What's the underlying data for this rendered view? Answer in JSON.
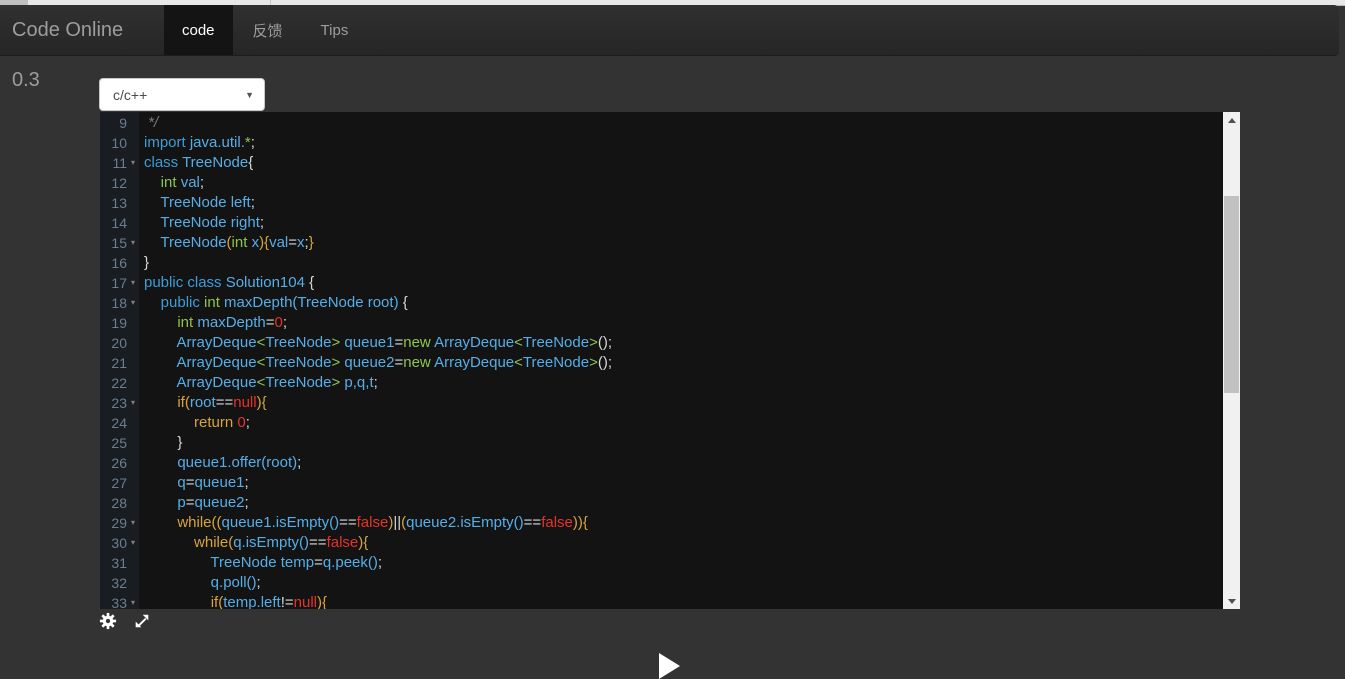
{
  "top_nav": {
    "brand": "Code Online 0.3",
    "tabs": [
      {
        "label": "code",
        "active": true
      },
      {
        "label": "反馈",
        "active": false
      },
      {
        "label": "Tips",
        "active": false
      }
    ]
  },
  "toolbar": {
    "language_select": {
      "value": "c/c++",
      "caret_icon": "▼"
    }
  },
  "colors": {
    "page_bg": "#333333",
    "navbar_bg": "#2b2b2b",
    "active_tab_bg": "#141414",
    "editor_bg": "#131313",
    "gutter_bg": "#191d22",
    "line_number": "#6b7e8f",
    "keyword_blue": "#3c9dd8",
    "keyword_green": "#8dc54f",
    "keyword_gold": "#d6a53c",
    "identifier_blue": "#56aee8",
    "literal_red": "#e5332b",
    "punctuation": "#d8d8d8",
    "comment_gray": "#7b7b7b",
    "scrollbar_track": "#f1f1f1",
    "scrollbar_thumb": "#c1c1c1"
  },
  "editor": {
    "fold_lines": [
      11,
      15,
      17,
      18,
      23,
      29,
      30,
      33
    ],
    "fold_icon": "▾",
    "lines": [
      {
        "n": 9,
        "tokens": [
          [
            " */",
            "com"
          ]
        ]
      },
      {
        "n": 10,
        "tokens": [
          [
            "import ",
            "kb"
          ],
          [
            "java.util.",
            "id"
          ],
          [
            "*",
            "kg"
          ],
          [
            ";",
            "pun"
          ]
        ]
      },
      {
        "n": 11,
        "tokens": [
          [
            "class ",
            "kb"
          ],
          [
            "TreeNode",
            "id"
          ],
          [
            "{",
            "pun"
          ]
        ]
      },
      {
        "n": 12,
        "tokens": [
          [
            "    ",
            "pun"
          ],
          [
            "int ",
            "kg"
          ],
          [
            "val",
            "id"
          ],
          [
            ";",
            "pun"
          ]
        ]
      },
      {
        "n": 13,
        "tokens": [
          [
            "    TreeNode left",
            "id"
          ],
          [
            ";",
            "pun"
          ]
        ]
      },
      {
        "n": 14,
        "tokens": [
          [
            "    TreeNode right",
            "id"
          ],
          [
            ";",
            "pun"
          ]
        ]
      },
      {
        "n": 15,
        "tokens": [
          [
            "    TreeNode",
            "id"
          ],
          [
            "(",
            "kd"
          ],
          [
            "int ",
            "kg"
          ],
          [
            "x",
            "id"
          ],
          [
            "){",
            "kd"
          ],
          [
            "val",
            "id"
          ],
          [
            "=",
            "pun"
          ],
          [
            "x",
            "id"
          ],
          [
            ";",
            "pun"
          ],
          [
            "}",
            "kd"
          ]
        ]
      },
      {
        "n": 16,
        "tokens": [
          [
            "}",
            "pun"
          ]
        ]
      },
      {
        "n": 17,
        "tokens": [
          [
            "public class ",
            "kb"
          ],
          [
            "Solution104 ",
            "id"
          ],
          [
            "{",
            "pun"
          ]
        ]
      },
      {
        "n": 18,
        "tokens": [
          [
            "    ",
            "pun"
          ],
          [
            "public ",
            "kb"
          ],
          [
            "int ",
            "kg"
          ],
          [
            "maxDepth(TreeNode root)",
            "id"
          ],
          [
            " {",
            "pun"
          ]
        ]
      },
      {
        "n": 19,
        "tokens": [
          [
            "        ",
            "pun"
          ],
          [
            "int ",
            "kg"
          ],
          [
            "maxDepth",
            "id"
          ],
          [
            "=",
            "pun"
          ],
          [
            "0",
            "lit"
          ],
          [
            ";",
            "pun"
          ]
        ]
      },
      {
        "n": 20,
        "tokens": [
          [
            "        ArrayDeque",
            "id"
          ],
          [
            "<",
            "kg"
          ],
          [
            "TreeNode",
            "id"
          ],
          [
            "> ",
            "kg"
          ],
          [
            "queue1",
            "id"
          ],
          [
            "=",
            "pun"
          ],
          [
            "new ",
            "kg"
          ],
          [
            "ArrayDeque",
            "id"
          ],
          [
            "<",
            "kg"
          ],
          [
            "TreeNode",
            "id"
          ],
          [
            ">",
            "kg"
          ],
          [
            "();",
            "pun"
          ]
        ]
      },
      {
        "n": 21,
        "tokens": [
          [
            "        ArrayDeque",
            "id"
          ],
          [
            "<",
            "kg"
          ],
          [
            "TreeNode",
            "id"
          ],
          [
            "> ",
            "kg"
          ],
          [
            "queue2",
            "id"
          ],
          [
            "=",
            "pun"
          ],
          [
            "new ",
            "kg"
          ],
          [
            "ArrayDeque",
            "id"
          ],
          [
            "<",
            "kg"
          ],
          [
            "TreeNode",
            "id"
          ],
          [
            ">",
            "kg"
          ],
          [
            "();",
            "pun"
          ]
        ]
      },
      {
        "n": 22,
        "tokens": [
          [
            "        ArrayDeque",
            "id"
          ],
          [
            "<",
            "kg"
          ],
          [
            "TreeNode",
            "id"
          ],
          [
            "> ",
            "kg"
          ],
          [
            "p,q,t",
            "id"
          ],
          [
            ";",
            "pun"
          ]
        ]
      },
      {
        "n": 23,
        "tokens": [
          [
            "        ",
            "pun"
          ],
          [
            "if(",
            "kd"
          ],
          [
            "root",
            "id"
          ],
          [
            "==",
            "pun"
          ],
          [
            "null",
            "lit"
          ],
          [
            "){",
            "kd"
          ]
        ]
      },
      {
        "n": 24,
        "tokens": [
          [
            "            ",
            "pun"
          ],
          [
            "return ",
            "kd"
          ],
          [
            "0",
            "lit"
          ],
          [
            ";",
            "pun"
          ]
        ]
      },
      {
        "n": 25,
        "tokens": [
          [
            "        }",
            "pun"
          ]
        ]
      },
      {
        "n": 26,
        "tokens": [
          [
            "        queue1.offer(root)",
            "id"
          ],
          [
            ";",
            "pun"
          ]
        ]
      },
      {
        "n": 27,
        "tokens": [
          [
            "        q",
            "id"
          ],
          [
            "=",
            "pun"
          ],
          [
            "queue1",
            "id"
          ],
          [
            ";",
            "pun"
          ]
        ]
      },
      {
        "n": 28,
        "tokens": [
          [
            "        p",
            "id"
          ],
          [
            "=",
            "pun"
          ],
          [
            "queue2",
            "id"
          ],
          [
            ";",
            "pun"
          ]
        ]
      },
      {
        "n": 29,
        "tokens": [
          [
            "        ",
            "pun"
          ],
          [
            "while((",
            "kd"
          ],
          [
            "queue1.isEmpty()",
            "id"
          ],
          [
            "==",
            "pun"
          ],
          [
            "false",
            "lit"
          ],
          [
            ")",
            "kd"
          ],
          [
            "||",
            "pun"
          ],
          [
            "(",
            "kd"
          ],
          [
            "queue2.isEmpty()",
            "id"
          ],
          [
            "==",
            "pun"
          ],
          [
            "false",
            "lit"
          ],
          [
            ")){",
            "kd"
          ]
        ]
      },
      {
        "n": 30,
        "tokens": [
          [
            "            ",
            "pun"
          ],
          [
            "while(",
            "kd"
          ],
          [
            "q.isEmpty()",
            "id"
          ],
          [
            "==",
            "pun"
          ],
          [
            "false",
            "lit"
          ],
          [
            "){",
            "kd"
          ]
        ]
      },
      {
        "n": 31,
        "tokens": [
          [
            "                TreeNode temp",
            "id"
          ],
          [
            "=",
            "pun"
          ],
          [
            "q.peek()",
            "id"
          ],
          [
            ";",
            "pun"
          ]
        ]
      },
      {
        "n": 32,
        "tokens": [
          [
            "                q.poll()",
            "id"
          ],
          [
            ";",
            "pun"
          ]
        ]
      },
      {
        "n": 33,
        "tokens": [
          [
            "                ",
            "pun"
          ],
          [
            "if(",
            "kd"
          ],
          [
            "temp.left",
            "id"
          ],
          [
            "!=",
            "pun"
          ],
          [
            "null",
            "lit"
          ],
          [
            "){",
            "kd"
          ]
        ]
      }
    ]
  },
  "footer": {
    "icons": [
      "settings-icon",
      "expand-icon",
      "play-icon"
    ]
  }
}
